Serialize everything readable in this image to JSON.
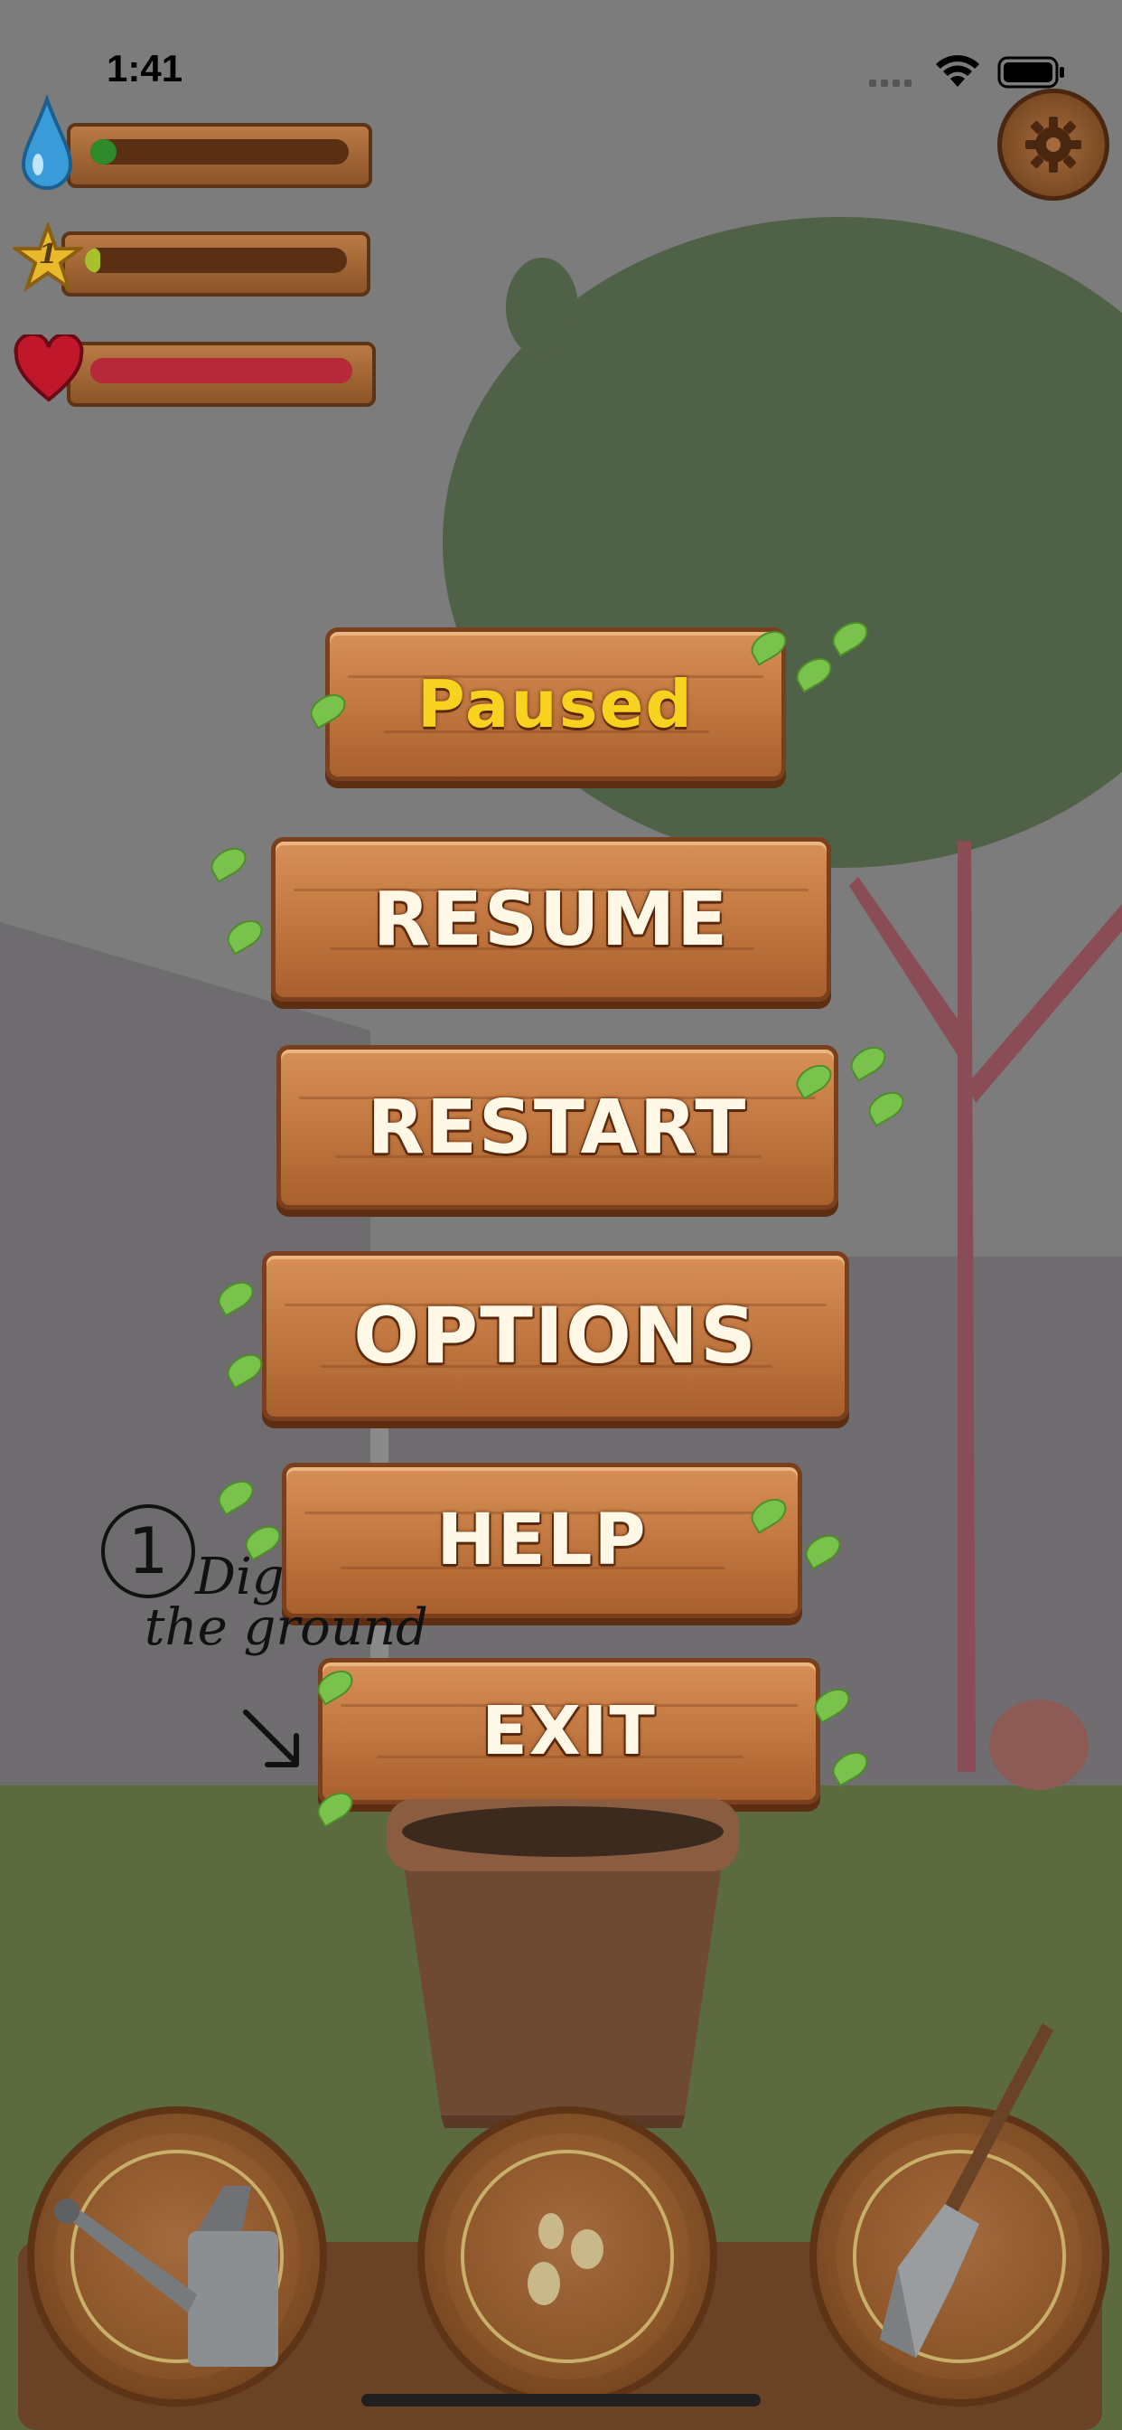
{
  "status_bar": {
    "time": "1:41"
  },
  "hud": {
    "water": {
      "icon": "water-drop-icon",
      "level": 0.1,
      "color": "#2f8a2a"
    },
    "star": {
      "icon": "star-icon",
      "badge": "1",
      "level": 0.05,
      "color": "#a7c12a"
    },
    "health": {
      "icon": "heart-icon",
      "level": 1.0,
      "color": "#b8283b"
    }
  },
  "settings": {
    "icon": "gear-icon"
  },
  "pause_menu": {
    "title": "Paused",
    "buttons": [
      "RESUME",
      "RESTART",
      "OPTIONS",
      "HELP",
      "EXIT"
    ]
  },
  "tutorial": {
    "step": "1",
    "text_line1": "Dig",
    "text_line2": "the ground"
  },
  "toolbar": {
    "tools": [
      "watering-can-icon",
      "seeds-icon",
      "shovel-icon"
    ]
  },
  "colors": {
    "title": "#f7d21f",
    "button_text": "#fff8e6",
    "wood": "#c47a42",
    "overlay": "#7b7c7b"
  }
}
